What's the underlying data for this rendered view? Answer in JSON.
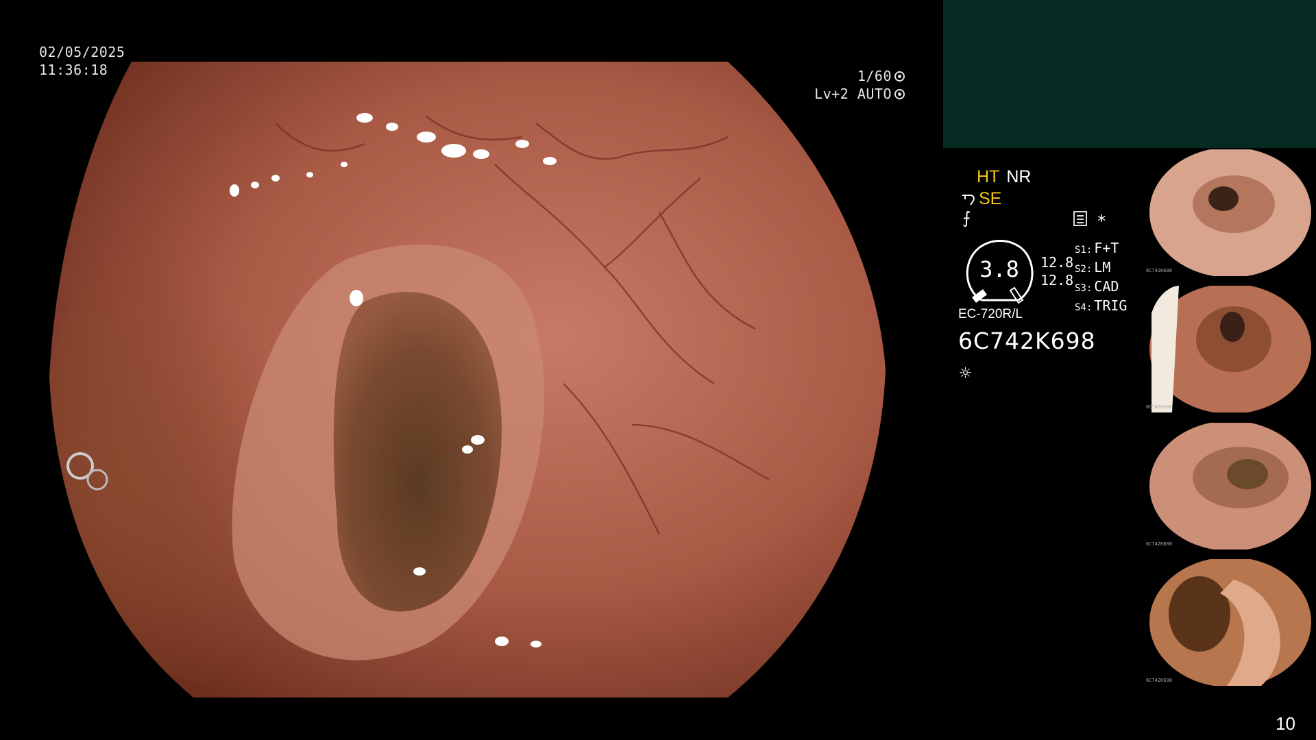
{
  "overlay": {
    "date": "02/05/2025",
    "time": "11:36:18",
    "shutter": "1/60",
    "iris": "Lv+2 AUTO"
  },
  "status": {
    "ht": "HT",
    "nr": "NR",
    "se": "SE",
    "dial_value": "3.8",
    "gain_top": "12.8",
    "gain_bottom": "12.8",
    "switches": [
      {
        "key": "S1:",
        "value": "F+T"
      },
      {
        "key": "S2:",
        "value": "LM"
      },
      {
        "key": "S3:",
        "value": "CAD"
      },
      {
        "key": "S4:",
        "value": "TRIG"
      }
    ],
    "scope_model": "EC-720R/L",
    "scope_serial": "6C742K698"
  },
  "icons": {
    "se_prefix": "scope-bend-icon",
    "freeze": "freeze-icon",
    "memo": "memo-icon",
    "star": "asterisk-icon",
    "light": "light-source-icon",
    "shutter": "aperture-icon",
    "iris": "iris-icon"
  },
  "colors": {
    "accent_yellow": "#f5c516",
    "panel_green": "#052a22",
    "mucosa": "#b8644f"
  },
  "thumbnails": [
    {
      "serial": "6C742K698"
    },
    {
      "serial": "6C742K698"
    },
    {
      "serial": "6C742K698"
    },
    {
      "serial": "6C742K698"
    }
  ],
  "page_number": "10"
}
